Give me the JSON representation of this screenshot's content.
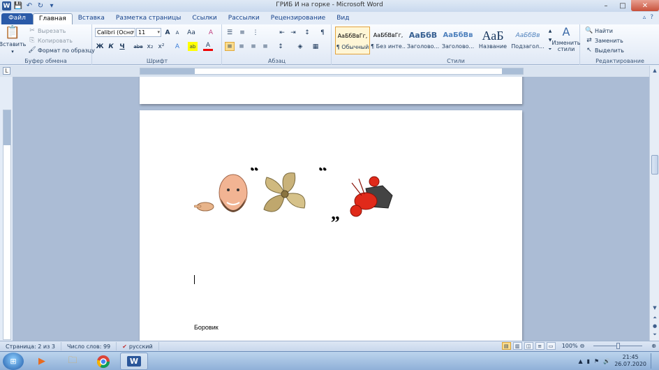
{
  "window": {
    "title": "ГРИБ И на горке - Microsoft Word",
    "min": "–",
    "max": "□",
    "close": "✕"
  },
  "tabs": [
    "Файл",
    "Главная",
    "Вставка",
    "Разметка страницы",
    "Ссылки",
    "Рассылки",
    "Рецензирование",
    "Вид"
  ],
  "clipboard": {
    "paste": "Вставить",
    "cut": "Вырезать",
    "copy": "Копировать",
    "format_painter": "Формат по образцу",
    "label": "Буфер обмена"
  },
  "font": {
    "name": "Calibri (Осно",
    "size": "11",
    "label": "Шрифт",
    "bold": "Ж",
    "italic": "К",
    "underline": "Ч",
    "strike": "abe",
    "sub": "x₂",
    "sup": "x²",
    "grow": "A",
    "shrink": "A",
    "case": "Aa",
    "clear": "A",
    "effects": "A",
    "highlight": "ab",
    "color": "A"
  },
  "paragraph": {
    "label": "Абзац",
    "pilcrow": "¶"
  },
  "styles": {
    "label": "Стили",
    "items": [
      {
        "sample": "АаБбВвГг,",
        "name": "¶ Обычный"
      },
      {
        "sample": "АаБбВвГг,",
        "name": "¶ Без инте..."
      },
      {
        "sample": "АаБбВ",
        "name": "Заголово..."
      },
      {
        "sample": "АаБбВв",
        "name": "Заголово..."
      },
      {
        "sample": "АаБ",
        "name": "Название"
      },
      {
        "sample": "АаБбВв",
        "name": "Подзагол..."
      }
    ],
    "change": "Изменить стили"
  },
  "editing": {
    "label": "Редактирование",
    "find": "Найти",
    "replace": "Заменить",
    "select": "Выделить"
  },
  "document": {
    "bottom_text": "Боровик"
  },
  "status": {
    "page": "Страница: 2 из 3",
    "words": "Число слов: 99",
    "language": "русский",
    "zoom": "100%"
  },
  "taskbar": {
    "time": "21:45",
    "date": "26.07.2020"
  }
}
